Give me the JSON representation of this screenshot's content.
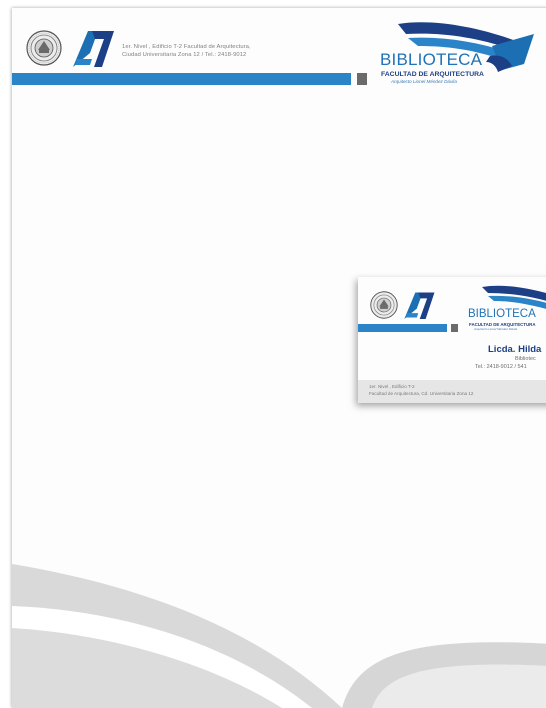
{
  "letterhead": {
    "address_line_1": "1er. Nivel , Edificio T-2 Facultad de Arquitectura,",
    "address_line_2": "Ciudad Universitaria Zona 12 / Tel.: 2418-9012",
    "logo_word": "BIBLIOTECA",
    "logo_faculty": "FACULTAD DE ARQUITECTURA",
    "logo_subtitle": "Arquitecto Lionel Méndez Dávila"
  },
  "card": {
    "logo_word": "BIBLIOTECA",
    "logo_faculty": "FACULTAD DE ARQUITECTURA",
    "logo_subtitle": "Arquitecto Lionel Méndez Dávila",
    "name": "Licda. Hilda",
    "role": "Bibliotec",
    "tel": "Tel.: 2418-9012 / 541",
    "address_line_1": "1er. Nivel , Edificio T-2",
    "address_line_2": "Facultad de Arquitectura, Cd. Universitaria Zona 12"
  },
  "colors": {
    "accent_blue": "#2a84c7",
    "dark_blue": "#1d3f86",
    "gray_square": "#6b6b6b",
    "swoosh_gray": "#d9d9d9"
  }
}
